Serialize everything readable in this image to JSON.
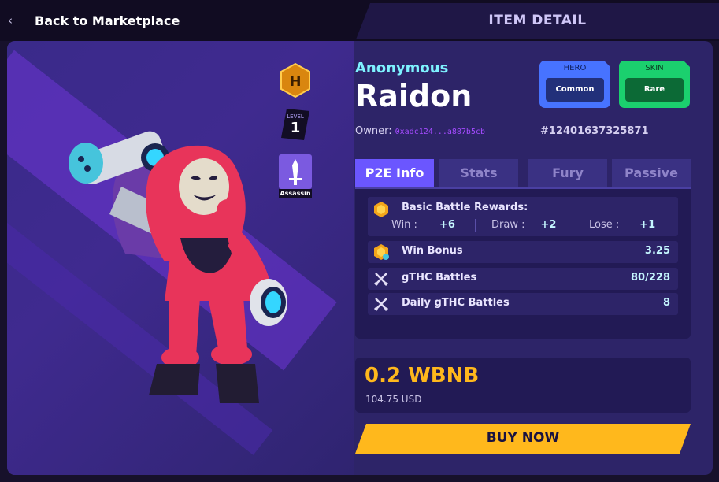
{
  "nav": {
    "back_label": "Back to Marketplace",
    "page_title": "ITEM DETAIL"
  },
  "badges": {
    "rarity_letter": "H",
    "level_label": "LEVEL",
    "level_value": "1",
    "class_label": "Assassin"
  },
  "item": {
    "subtitle": "Anonymous",
    "name": "Raidon",
    "owner_label": "Owner:",
    "owner_address": "0xadc124...a887b5cb",
    "token_id": "#12401637325871"
  },
  "tags": {
    "hero": {
      "label": "HERO",
      "value": "Common"
    },
    "skin": {
      "label": "SKIN",
      "value": "Rare"
    }
  },
  "tabs": [
    {
      "label": "P2E Info",
      "active": true
    },
    {
      "label": "Stats",
      "active": false
    },
    {
      "label": "Fury",
      "active": false
    },
    {
      "label": "Passive",
      "active": false
    }
  ],
  "p2e": {
    "basic_rewards": {
      "label": "Basic Battle Rewards:",
      "win_label": "Win :",
      "win_value": "+6",
      "draw_label": "Draw :",
      "draw_value": "+2",
      "lose_label": "Lose :",
      "lose_value": "+1"
    },
    "win_bonus": {
      "label": "Win Bonus",
      "value": "3.25"
    },
    "gthc_battles": {
      "label": "gTHC Battles",
      "value": "80/228"
    },
    "daily_gthc_battles": {
      "label": "Daily gTHC Battles",
      "value": "8"
    }
  },
  "price": {
    "amount": "0.2 WBNB",
    "usd": "104.75 USD"
  },
  "buy_button": "BUY NOW",
  "colors": {
    "accent": "#6b56ff",
    "price": "#ffb81c",
    "cyan": "#7ef2ff",
    "hero_tag": "#4773ff",
    "skin_tag": "#1bd06e"
  }
}
